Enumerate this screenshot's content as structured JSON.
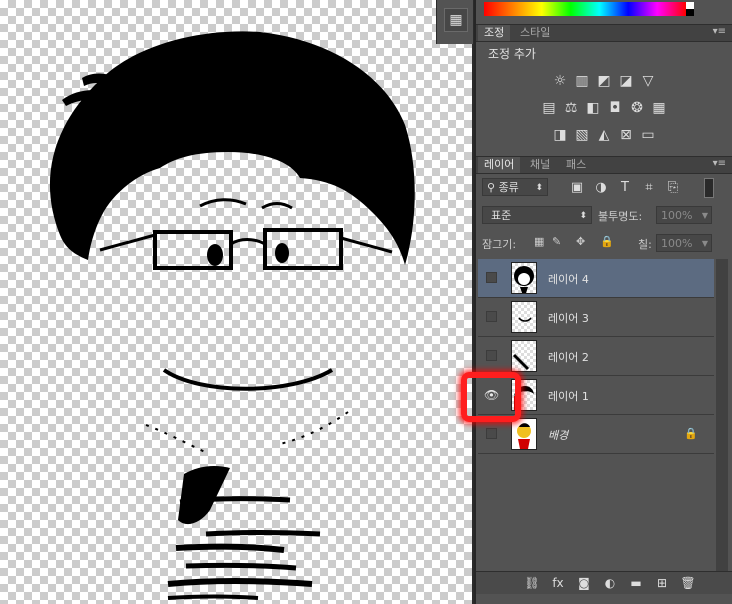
{
  "adjustments_panel": {
    "tabs": [
      "조정",
      "스타일"
    ],
    "title": "조정 추가",
    "row1_icons": [
      "brightness-icon",
      "levels-icon",
      "curves-icon",
      "exposure-icon",
      "vibrance-icon"
    ],
    "row2_icons": [
      "hue-saturation-icon",
      "color-balance-icon",
      "black-white-icon",
      "photo-filter-icon",
      "channel-mixer-icon",
      "color-lookup-icon"
    ],
    "row3_icons": [
      "invert-icon",
      "posterize-icon",
      "threshold-icon",
      "selective-color-icon",
      "gradient-map-icon"
    ]
  },
  "layers_panel": {
    "tabs": [
      "레이어",
      "채널",
      "패스"
    ],
    "filter_kind": "종류",
    "blend_mode": "표준",
    "opacity_label": "불투명도:",
    "opacity_value": "100%",
    "lock_label": "잠그기:",
    "fill_label": "칠:",
    "fill_value": "100%",
    "layers": [
      {
        "name": "레이어 4",
        "visible": false,
        "selected": true
      },
      {
        "name": "레이어 3",
        "visible": false,
        "selected": false
      },
      {
        "name": "레이어 2",
        "visible": false,
        "selected": false
      },
      {
        "name": "레이어 1",
        "visible": true,
        "selected": false
      },
      {
        "name": "배경",
        "visible": false,
        "selected": false,
        "locked": true
      }
    ]
  },
  "icons": {
    "eye": "👁",
    "lock": "🔒",
    "panel_menu": "▾≡",
    "dropdown": "⬍"
  },
  "colors": {
    "panel_bg": "#535353",
    "selected_layer": "#5c6b81",
    "highlight": "#ff1e1e"
  }
}
